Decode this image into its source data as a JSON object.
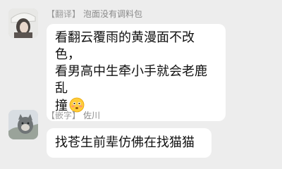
{
  "messages": [
    {
      "sender_tag": "【翻译】",
      "sender_name": "泡面没有调料包",
      "lines": [
        "看翻云覆雨的黄漫面不改色，",
        "看男高中生牵小手就会老鹿乱",
        "撞"
      ],
      "emoji": "flushed-face-emoji"
    },
    {
      "sender_tag": "【嵌字】",
      "sender_name": "佐川",
      "lines": [
        "找苍生前辈仿佛在找猫猫"
      ]
    }
  ],
  "colors": {
    "background": "#ededed",
    "bubble": "#ffffff",
    "sender_text": "#8a8a8a",
    "message_text": "#111111"
  }
}
